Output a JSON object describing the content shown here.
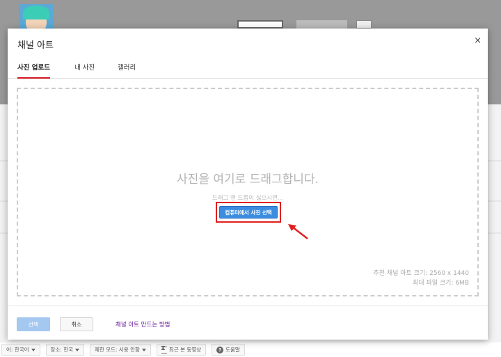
{
  "modal": {
    "title": "채널 아트",
    "close_label": "×",
    "tabs": [
      {
        "label": "사진 업로드",
        "active": true
      },
      {
        "label": "내 사진",
        "active": false
      },
      {
        "label": "갤러리",
        "active": false
      }
    ],
    "drop_zone": {
      "main_text": "사진을 여기로 드래그합니다.",
      "sub_text": "드래그 앤 드롭이 싫으시면...",
      "select_button": "컴퓨터에서 사진 선택",
      "recommended_size": "추천 채널 아트 크기: 2560 x 1440",
      "max_file_size": "최대 파일 크기: 6MB"
    },
    "footer": {
      "select_label": "선택",
      "cancel_label": "취소",
      "help_link": "채널 아트 만드는 방법"
    }
  },
  "page_footer": {
    "language": "어: 한국어",
    "location": "장소: 한국",
    "restricted_mode": "제한 모드: 사용 안함",
    "history": "최근 본 동영상",
    "help": "도움말"
  },
  "colors": {
    "accent_red": "#cc181e",
    "highlight_red": "#e02020",
    "button_blue": "#3c8de0",
    "disabled_blue": "#a4c8f0",
    "link_purple": "#6a1b9a"
  },
  "icons": {
    "close": "close-icon",
    "dropdown": "caret-down-icon",
    "history": "hourglass-icon",
    "help": "question-icon",
    "annotation": "red-arrow-icon"
  }
}
